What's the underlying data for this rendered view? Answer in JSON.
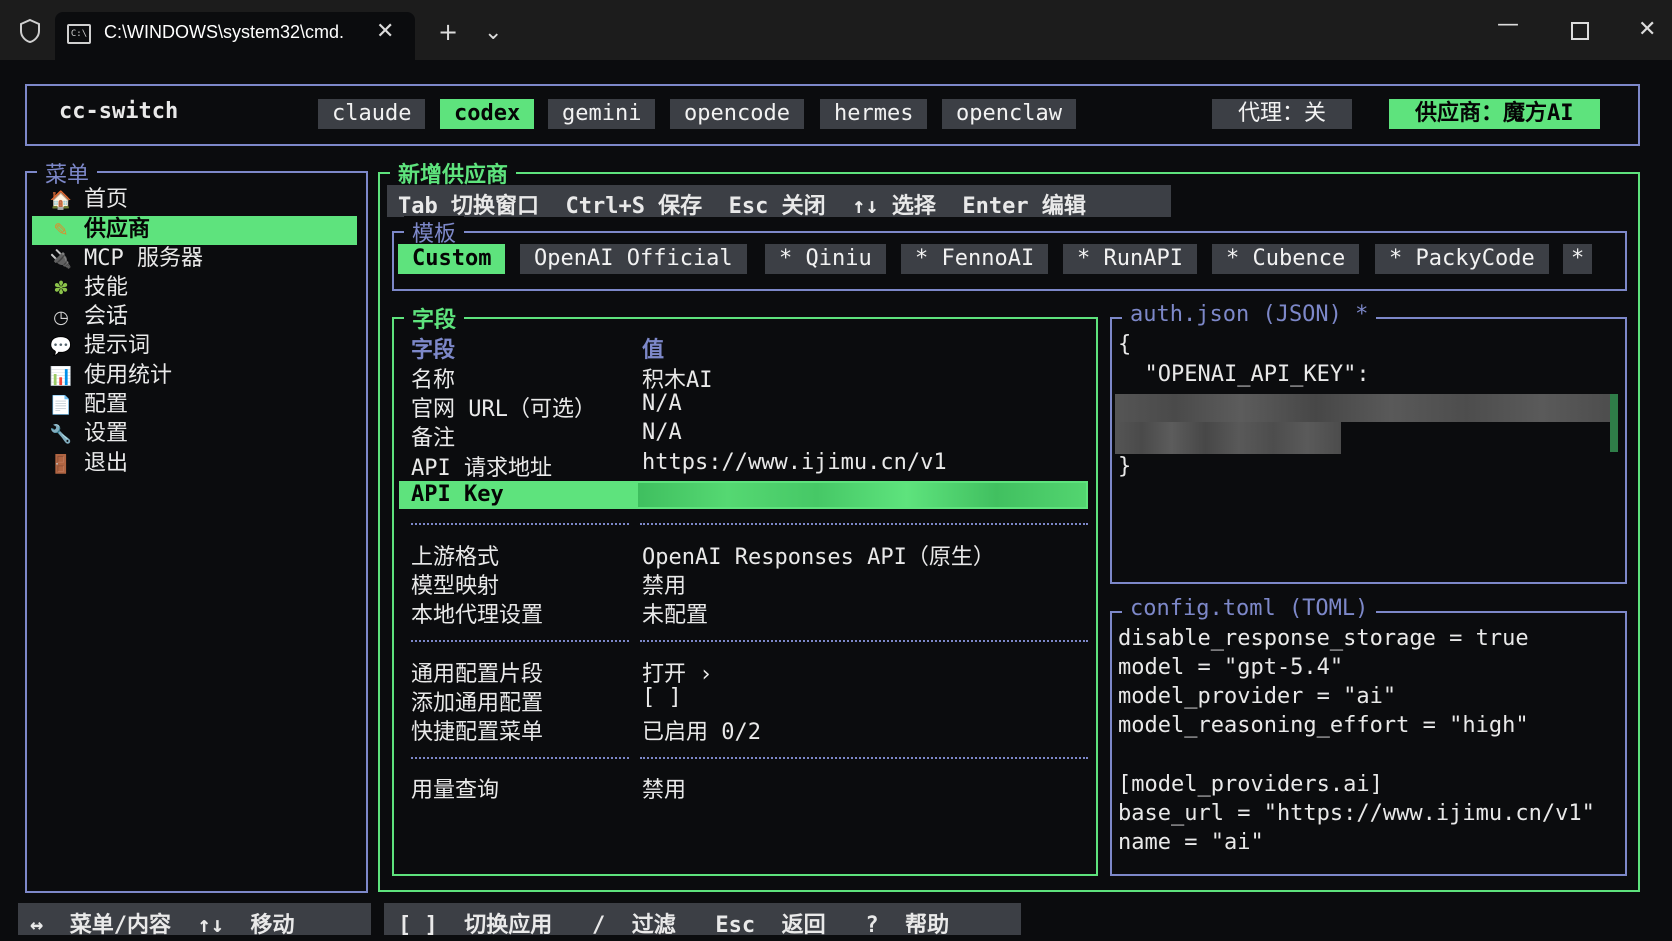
{
  "window": {
    "tab_title": "C:\\WINDOWS\\system32\\cmd.",
    "icons": [
      "shield-icon",
      "cmd-icon",
      "close-icon",
      "plus-icon",
      "chevron-down-icon",
      "minimize-icon",
      "maximize-icon",
      "close-window-icon"
    ]
  },
  "header": {
    "app_name": "cc-switch",
    "apps": [
      "claude",
      "codex",
      "gemini",
      "opencode",
      "hermes",
      "openclaw"
    ],
    "active_app": "codex",
    "proxy": "代理：关",
    "provider": "供应商：魔方AI"
  },
  "menu": {
    "title": "菜单",
    "items": [
      {
        "icon": "house-icon",
        "label": "首页"
      },
      {
        "icon": "pencil-icon",
        "label": "供应商"
      },
      {
        "icon": "plug-icon",
        "label": "MCP 服务器"
      },
      {
        "icon": "puzzle-icon",
        "label": "技能"
      },
      {
        "icon": "clock-icon",
        "label": "会话"
      },
      {
        "icon": "speech-bubble-icon",
        "label": "提示词"
      },
      {
        "icon": "bar-chart-icon",
        "label": "使用统计"
      },
      {
        "icon": "document-icon",
        "label": "配置"
      },
      {
        "icon": "wrench-icon",
        "label": "设置"
      },
      {
        "icon": "door-icon",
        "label": "退出"
      }
    ],
    "active": "供应商"
  },
  "main": {
    "title": "新增供应商",
    "shortcuts": "Tab 切换窗口  Ctrl+S 保存  Esc 关闭  ↑↓ 选择  Enter 编辑",
    "templates": {
      "title": "模板",
      "items": [
        "Custom",
        "OpenAI Official",
        "* Qiniu",
        "* FennoAI",
        "* RunAPI",
        "* Cubence",
        "* PackyCode",
        "*"
      ],
      "active": "Custom"
    },
    "fields": {
      "title": "字段",
      "col_field": "字段",
      "col_value": "值",
      "group1": [
        {
          "k": "名称",
          "v": "积木AI"
        },
        {
          "k": "官网 URL（可选）",
          "v": "N/A"
        },
        {
          "k": "备注",
          "v": "N/A"
        },
        {
          "k": "API 请求地址",
          "v": "https://www.ijimu.cn/v1"
        }
      ],
      "selected": {
        "k": "API Key",
        "v": ""
      },
      "group2": [
        {
          "k": "上游格式",
          "v": "OpenAI Responses API（原生）"
        },
        {
          "k": "模型映射",
          "v": "禁用"
        },
        {
          "k": "本地代理设置",
          "v": "未配置"
        }
      ],
      "group3": [
        {
          "k": "通用配置片段",
          "v": "打开 ›"
        },
        {
          "k": "添加通用配置",
          "v": "[ ]"
        },
        {
          "k": "快捷配置菜单",
          "v": "已启用 0/2"
        }
      ],
      "group4": [
        {
          "k": "用量查询",
          "v": "禁用"
        }
      ]
    },
    "auth_json": {
      "title": "auth.json (JSON) *",
      "lines": [
        "{",
        "  \"OPENAI_API_KEY\":",
        "}"
      ]
    },
    "config_toml": {
      "title": "config.toml (TOML)",
      "lines": [
        "disable_response_storage = true",
        "model = \"gpt-5.4\"",
        "model_provider = \"ai\"",
        "model_reasoning_effort = \"high\"",
        "",
        "[model_providers.ai]",
        "base_url = \"https://www.ijimu.cn/v1\"",
        "name = \"ai\""
      ]
    }
  },
  "footer": {
    "left": "↔  菜单/内容  ↑↓  移动",
    "right": "[ ]  切换应用   /  过滤   Esc  返回   ?  帮助"
  },
  "colors": {
    "accent_green": "#5ee37d",
    "border_blue": "#7d88c9",
    "chip_gray": "#3c3f45",
    "background": "#0b0c0e"
  }
}
